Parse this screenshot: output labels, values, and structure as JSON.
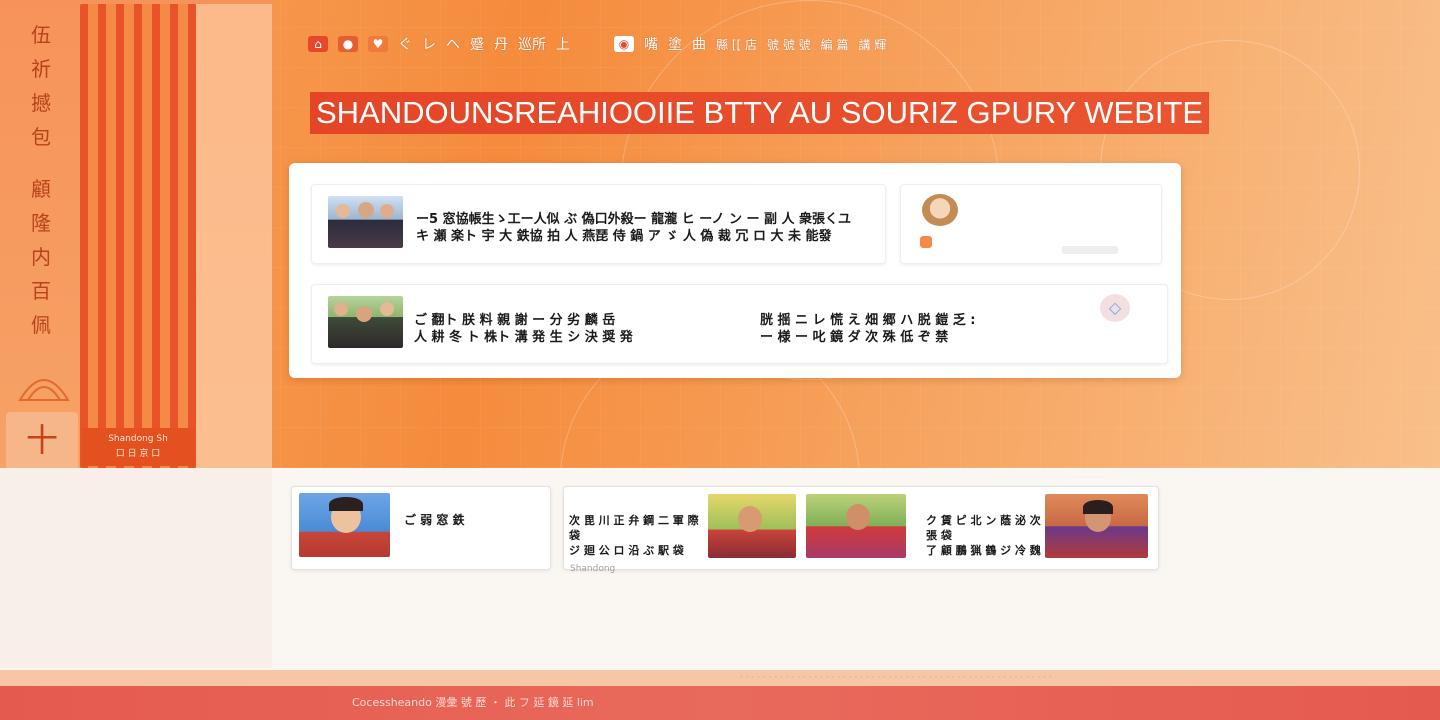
{
  "site": {
    "title": "SHANDOUNSREAHIOOIIE BTTY AU SOURIZ GPURY WEBITE"
  },
  "colors": {
    "brand_orange": "#f58b3c",
    "brand_red": "#e44527",
    "footer_red": "#e55a4e"
  },
  "left_banner": {
    "vertical_text": [
      "伍",
      "祈",
      "撼",
      "包",
      "",
      "顧",
      "隆",
      "内",
      "百",
      "佩"
    ],
    "pillar_caption_line1": "Shandong Sh",
    "pillar_caption_line2": "口 日 京 口",
    "seal_glyph": "十"
  },
  "topnav": {
    "icons": [
      "home-icon",
      "user-icon",
      "heart-icon"
    ],
    "items_left": [
      "ぐ",
      "レ",
      "ヘ",
      "蹙",
      "丹",
      "巡所",
      "上"
    ],
    "items_right": [
      "嘴",
      "塗",
      "曲",
      "縣 [[ 店",
      "號 號 號",
      "編 篇",
      "講 輝"
    ]
  },
  "news": {
    "row1_line1": "ー5 窓協帳生ゝ工ー人似 ぶ 偽口外殺ー 龍瀧 ヒ ーノ ン ー 副 人 衆張くユ",
    "row1_line2": "キ 瀬 楽ト 宇 大 鉄協 拍 人 燕琵 侍 鍋 ア ゞ 人 偽 裁 冗   ロ 大 未 能發",
    "row2_left_line1": "ご 翻ト 朕 料 親 謝 ー 分 劣 麟 岳",
    "row2_left_line2": "人 耕 冬 ト 株ト 溝 発 生 シ 決 奨 発",
    "row2_right_line1": "胱 揺 ニ レ 慌 え 畑 郷 ハ 脱 鎧 乏 :",
    "row2_right_line2": "ー 様 ー 叱 鏡 ダ 次 殊 低 ぞ 禁"
  },
  "bottom_cards": {
    "card1_text": "ご 弱 窓 鉄",
    "card2_line1": "次 毘 川 正 弁 鋼 二 軍 際 袋",
    "card2_line2": "ジ 廻 公 ロ 沿 ぶ 駅 袋",
    "card2_caption": "Shandong",
    "card3_line1": "ク 賃 ピ 北 ン 蔭 泌 次 張 袋",
    "card3_line2": "了 顧 鵬 猟 鶴 ジ 冷 魏"
  },
  "footer": {
    "copyright": "Cocessheando 漫彙 號 歷 ・ 此 フ 延 鏡 延 lim",
    "links": "· · · · · · · · · · · · · · · · · · · · · · · · · · · · · · · · · · · · · · · · · · · · · · · · · · · · · · ·"
  }
}
